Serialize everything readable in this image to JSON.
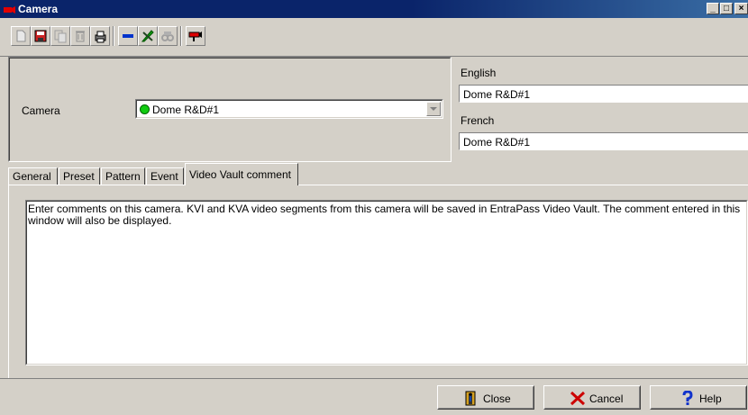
{
  "window": {
    "title": "Camera"
  },
  "toolbar": {
    "buttons": [
      "new-icon",
      "save-icon",
      "copy-icon",
      "delete-icon",
      "print-icon",
      "link-icon",
      "edit-link-icon",
      "search-icon",
      "camera-icon"
    ]
  },
  "header": {
    "camera_label": "Camera",
    "camera_value": "Dome R&D#1",
    "status_color": "#11cc11",
    "english_label": "English",
    "english_value": "Dome R&D#1",
    "french_label": "French",
    "french_value": "Dome R&D#1"
  },
  "tabs": [
    {
      "label": "General"
    },
    {
      "label": "Preset"
    },
    {
      "label": "Pattern"
    },
    {
      "label": "Event"
    },
    {
      "label": "Video Vault comment",
      "active": true
    }
  ],
  "comment": {
    "text": "Enter comments on this camera. KVI and KVA video segments from this camera will be saved in EntraPass Video Vault. The comment entered in this window will also be displayed."
  },
  "buttons": {
    "close": "Close",
    "cancel": "Cancel",
    "help": "Help"
  }
}
